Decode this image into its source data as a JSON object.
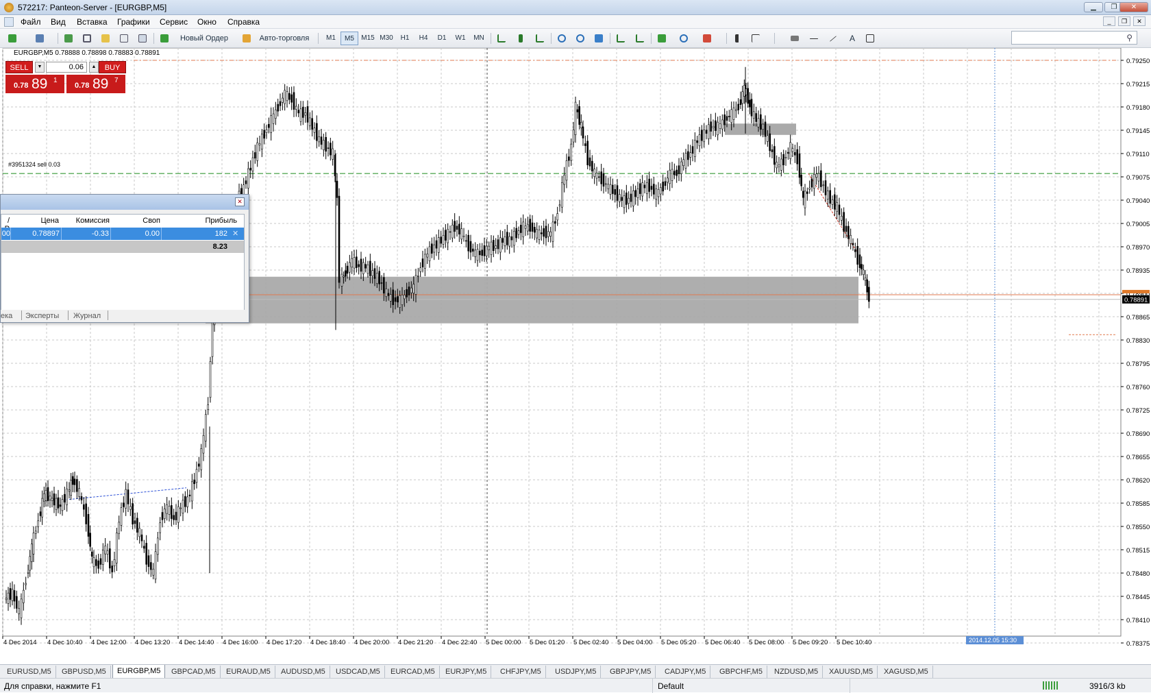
{
  "window": {
    "title": "572217: Panteon-Server - [EURGBP,M5]"
  },
  "menu": [
    "Файл",
    "Вид",
    "Вставка",
    "Графики",
    "Сервис",
    "Окно",
    "Справка"
  ],
  "toolbar": {
    "new_order": "Новый Ордер",
    "autotrading": "Авто-торговля",
    "timeframes": [
      "M1",
      "M5",
      "M15",
      "M30",
      "H1",
      "H4",
      "D1",
      "W1",
      "MN"
    ],
    "active_timeframe": "M5"
  },
  "chart": {
    "header": "EURGBP,M5  0.78888 0.78898 0.78883 0.78891",
    "order_label": "#3951324 sell 0.03",
    "current_price": "0.78891",
    "date_marker": "2014.12.05 15:30",
    "price_ticks": [
      "0.79250",
      "0.79215",
      "0.79180",
      "0.79145",
      "0.79110",
      "0.79075",
      "0.79040",
      "0.79005",
      "0.78970",
      "0.78935",
      "0.78900",
      "0.78865",
      "0.78830",
      "0.78795",
      "0.78760",
      "0.78725",
      "0.78690",
      "0.78655",
      "0.78620",
      "0.78585",
      "0.78550",
      "0.78515",
      "0.78480",
      "0.78445",
      "0.78410",
      "0.78375"
    ],
    "time_ticks": [
      "4 Dec 2014",
      "4 Dec 10:40",
      "4 Dec 12:00",
      "4 Dec 13:20",
      "4 Dec 14:40",
      "4 Dec 16:00",
      "4 Dec 17:20",
      "4 Dec 18:40",
      "4 Dec 20:00",
      "4 Dec 21:20",
      "4 Dec 22:40",
      "5 Dec 00:00",
      "5 Dec 01:20",
      "5 Dec 02:40",
      "5 Dec 04:00",
      "5 Dec 05:20",
      "5 Dec 06:40",
      "5 Dec 08:00",
      "5 Dec 09:20",
      "5 Dec 10:40"
    ],
    "colors": {
      "bull": "#000000",
      "bear": "#000000",
      "grid": "#c0c0c0",
      "stop_line": "#e0784f",
      "order_line": "#1a8a1a",
      "price_line": "#e0784f"
    }
  },
  "one_click": {
    "sell_label": "SELL",
    "buy_label": "BUY",
    "lot": "0.06",
    "sell_prefix": "0.78",
    "sell_big": "89",
    "sell_sup": "1",
    "buy_prefix": "0.78",
    "buy_big": "89",
    "buy_sup": "7"
  },
  "terminal": {
    "columns": [
      "/ P",
      "Цена",
      "Комиссия",
      "Своп",
      "Прибыль"
    ],
    "row": [
      "00",
      "0.78897",
      "-0.33",
      "0.00",
      "182"
    ],
    "total": "8.23",
    "tabs": [
      "ека",
      "Эксперты",
      "Журнал"
    ]
  },
  "symbol_tabs": [
    "EURUSD,M5",
    "GBPUSD,M5",
    "EURGBP,M5",
    "GBPCAD,M5",
    "EURAUD,M5",
    "AUDUSD,M5",
    "USDCAD,M5",
    "EURCAD,M5",
    "EURJPY,M5",
    "CHFJPY,M5",
    "USDJPY,M5",
    "GBPJPY,M5",
    "CADJPY,M5",
    "GBPCHF,M5",
    "NZDUSD,M5",
    "XAUUSD,M5",
    "XAGUSD,M5"
  ],
  "active_symbol": "EURGBP,M5",
  "status": {
    "help": "Для справки, нажмите F1",
    "profile": "Default",
    "traffic": "3916/3 kb"
  }
}
